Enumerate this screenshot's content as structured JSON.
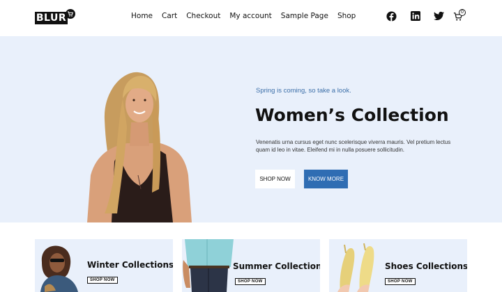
{
  "brand": {
    "logo_text": "BLUR"
  },
  "nav": {
    "items": [
      {
        "label": "Home"
      },
      {
        "label": "Cart"
      },
      {
        "label": "Checkout"
      },
      {
        "label": "My account"
      },
      {
        "label": "Sample Page"
      },
      {
        "label": "Shop"
      }
    ]
  },
  "header_icons": {
    "social": [
      "facebook-icon",
      "linkedin-icon",
      "twitter-icon"
    ],
    "cart": {
      "icon": "cart-icon",
      "count": "0"
    }
  },
  "hero": {
    "subtitle": "Spring is coming, so take a look.",
    "title": "Women’s Collection",
    "description": "Venenatis urna cursus eget nunc scelerisque viverra mauris. Vel pretium lectus quam id leo in vitae. Eleifend mi in nulla posuere sollicitudin.",
    "primary_button": "SHOP NOW",
    "secondary_button": "KNOW MORE"
  },
  "collections": [
    {
      "title": "Winter Collections",
      "button": "SHOP NOW"
    },
    {
      "title": "Summer Collections",
      "button": "SHOP NOW"
    },
    {
      "title": "Shoes Collections",
      "button": "SHOP NOW"
    }
  ],
  "colors": {
    "accent": "#2f6db3",
    "subtitle": "#3b6ea8",
    "hero_bg": "#e9f0fb",
    "text": "#111111"
  }
}
